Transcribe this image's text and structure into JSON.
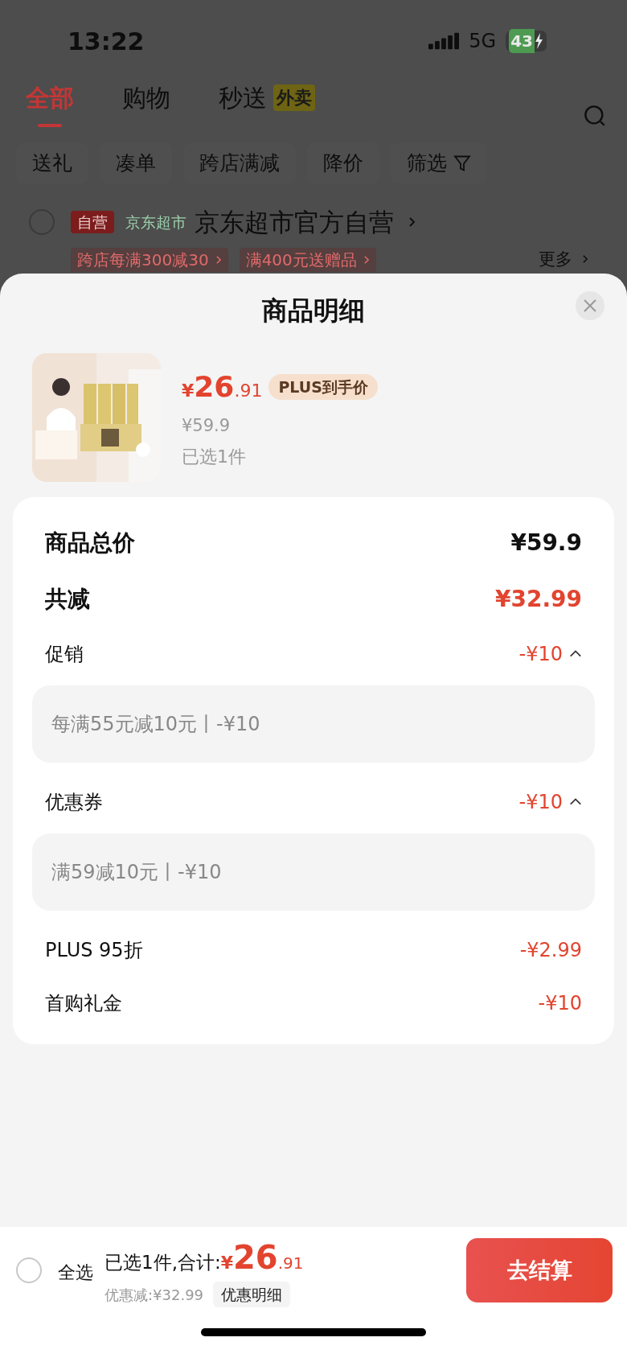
{
  "status_bar": {
    "time": "13:22",
    "network": "5G",
    "battery": "43"
  },
  "background": {
    "tabs": [
      {
        "label": "全部",
        "selected": true
      },
      {
        "label": "购物",
        "selected": false
      },
      {
        "label": "秒送",
        "selected": false,
        "badge": "外卖"
      }
    ],
    "filters": [
      "送礼",
      "凑单",
      "跨店满减",
      "降价",
      "筛选"
    ],
    "store": {
      "checked": false,
      "self_tag": "自营",
      "channel": "京东超市",
      "name": "京东超市官方自营"
    },
    "promos": [
      "跨店每满300减30",
      "满400元送赠品"
    ],
    "more": "更多"
  },
  "sheet": {
    "title": "商品明细",
    "product": {
      "price_symbol": "¥",
      "price_int": "26",
      "price_dec": ".91",
      "price_tag": "PLUS到手价",
      "original_price": "¥59.9",
      "quantity": "已选1件"
    },
    "total": {
      "label": "商品总价",
      "value": "¥59.9"
    },
    "discount": {
      "label": "共减",
      "value": "¥32.99"
    },
    "items": [
      {
        "kind": "group",
        "label": "促销",
        "value": "-¥10",
        "expanded": true,
        "detail": "每满55元减10元丨-¥10"
      },
      {
        "kind": "group",
        "label": "优惠券",
        "value": "-¥10",
        "expanded": true,
        "detail": "满59减10元丨-¥10"
      },
      {
        "kind": "line",
        "label": "PLUS 95折",
        "value": "-¥2.99"
      },
      {
        "kind": "line",
        "label": "首购礼金",
        "value": "-¥10"
      }
    ]
  },
  "bottom_bar": {
    "select_all": {
      "label": "全选",
      "checked": false
    },
    "summary": "已选1件,合计:",
    "price_symbol": "¥",
    "price_int": "26",
    "price_dec": ".91",
    "savings": "优惠减:¥32.99",
    "detail_button": "优惠明细",
    "checkout": "去结算"
  }
}
